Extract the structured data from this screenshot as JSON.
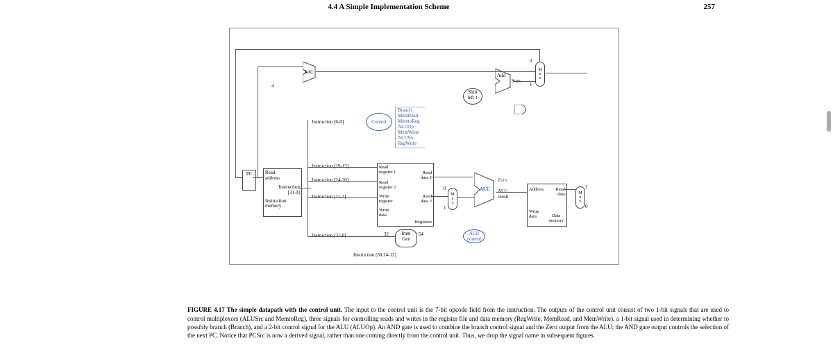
{
  "header": {
    "section": "4.4   A Simple Implementation Scheme",
    "page_number": "257"
  },
  "diagram": {
    "pc_label": "PC",
    "read_address": "Read\naddress",
    "instruction_memory": "Instruction\nmemory",
    "instruction_field": "Instruction\n[31-0]",
    "add_top": "Add",
    "const_4": "4",
    "add_sum": "Add",
    "sum_label": "Sum",
    "shift_left": "Shift\nleft 1",
    "mux_top": "M\nu\nx",
    "mux_top_0": "0",
    "mux_top_1": "1",
    "instr_6_0": "Instruction [6-0]",
    "control": "Control",
    "control_signals": {
      "branch": "Branch",
      "memread": "MemRead",
      "memtoreg": "MemtoReg",
      "aluop": "ALUOp",
      "memwrite": "MemWrite",
      "alusrc": "ALUSrc",
      "regwrite": "RegWrite"
    },
    "instr_19_15": "Instruction [19-15]",
    "instr_24_20": "Instruction [24-20]",
    "instr_11_7": "Instruction [11-7]",
    "instr_31_0": "Instruction [31-0]",
    "instr_30_14_12": "Instruction [30,14-12]",
    "registers": {
      "title": "Registers",
      "read_reg1": "Read\nregister 1",
      "read_reg2": "Read\nregister 2",
      "write_reg": "Write\nregister",
      "write_data": "Write\ndata",
      "read_data1": "Read\ndata 1",
      "read_data2": "Read\ndata 2"
    },
    "imm_gen": "Imm\nGen",
    "imm_in": "32",
    "imm_out": "64",
    "mux_mid": "M\nu\nx",
    "mux_mid_0": "0",
    "mux_mid_1": "1",
    "alu": "ALU",
    "alu_result": "ALU\nresult",
    "zero": "Zero",
    "alu_control": "ALU\ncontrol",
    "data_memory": {
      "title": "Data\nmemory",
      "address": "Address",
      "write_data": "Write\ndata",
      "read_data": "Read\ndata"
    },
    "mux_right": "M\nu\nx",
    "mux_right_1": "1",
    "mux_right_0": "0"
  },
  "caption": {
    "lead": "FIGURE 4.17   The simple datapath with the control unit.",
    "body": " The input to the control unit is the 7-bit opcode field from the instruction. The outputs of the control unit consist of two 1-bit signals that are used to control multiplexors (ALUSrc and MemtoReg), three signals for controlling reads and writes in the register file and data memory (RegWrite, MemRead, and MemWrite), a 1-bit signal used in determining whether to possibly branch (Branch), and a 2-bit control signal for the ALU (ALUOp). An AND gate is used to combine the branch control signal and the Zero output from the ALU; the AND gate output controls the selection of the next PC. Notice that PCSrc is now a derived signal, rather than one coming directly from the control unit. Thus, we drop the signal name in subsequent figures."
  }
}
